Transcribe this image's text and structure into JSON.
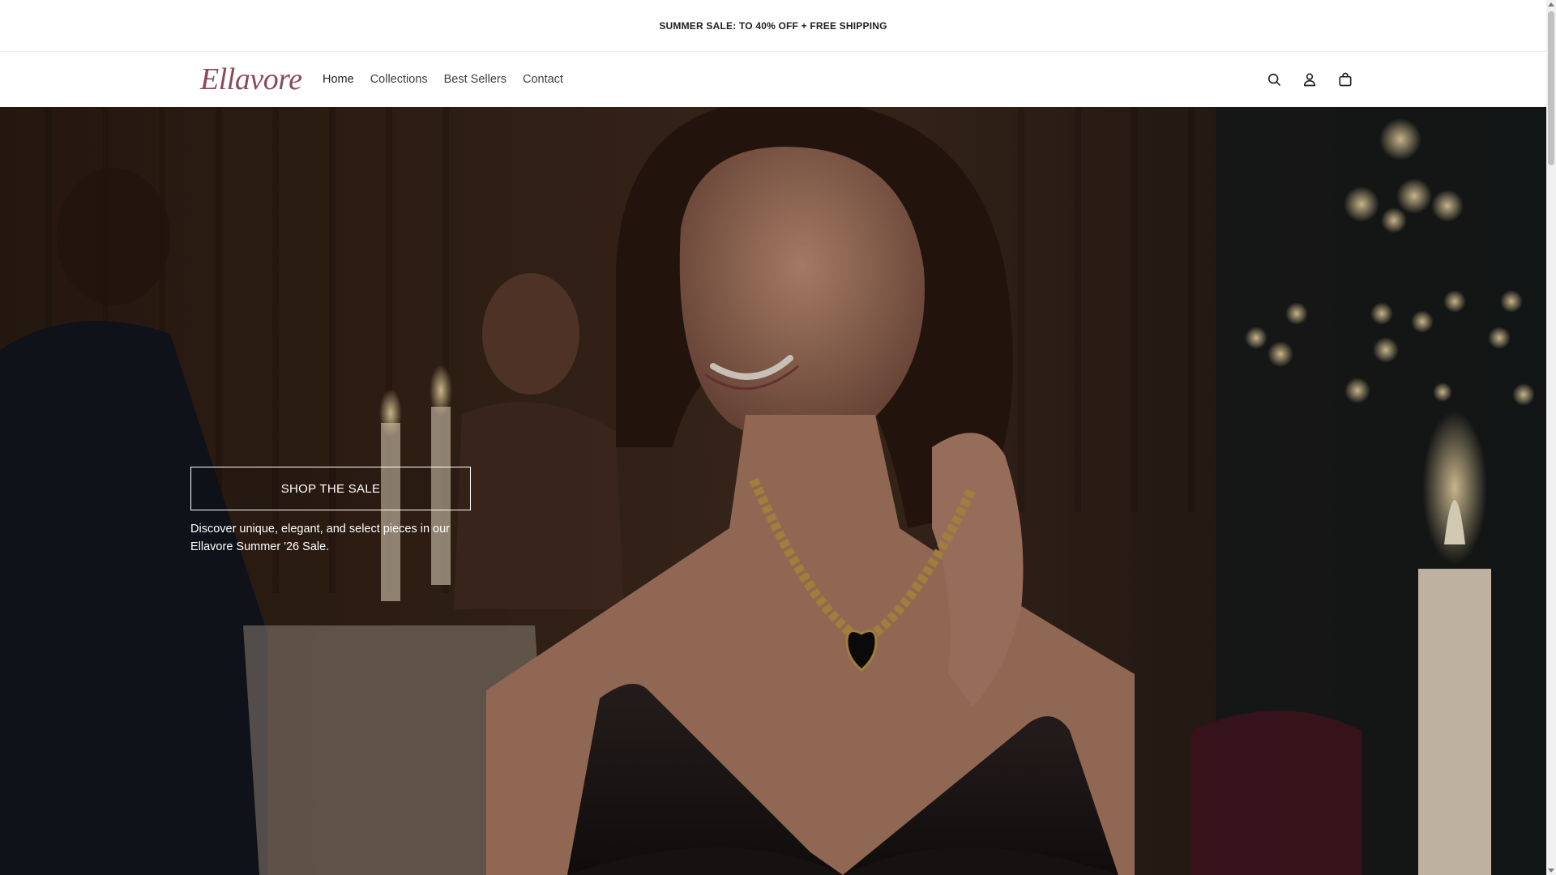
{
  "announcement": {
    "text": "SUMMER SALE: TO 40% OFF + FREE SHIPPING"
  },
  "header": {
    "logo": "Ellavore",
    "nav": [
      {
        "label": "Home",
        "active": true
      },
      {
        "label": "Collections",
        "active": false
      },
      {
        "label": "Best Sellers",
        "active": false
      },
      {
        "label": "Contact",
        "active": false
      }
    ],
    "icons": [
      "search-icon",
      "account-icon",
      "cart-icon"
    ]
  },
  "hero": {
    "cta_label": "SHOP THE SALE",
    "description": "Discover unique, elegant, and select pieces in our Ellavore Summer '26 Sale."
  },
  "colors": {
    "logo": "#8a4a5a",
    "text": "#1f1f1f",
    "hero_text": "#ffffff"
  }
}
